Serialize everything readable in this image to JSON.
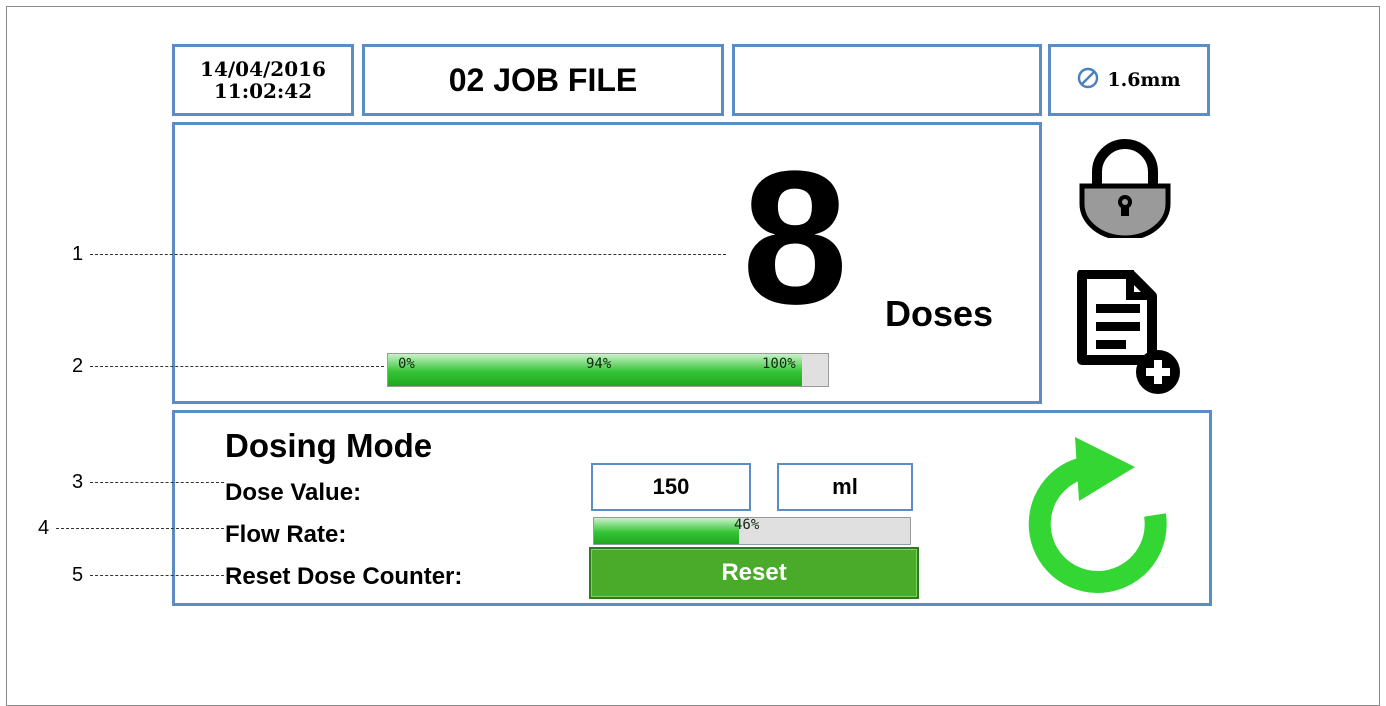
{
  "header": {
    "date": "14/04/2016",
    "time": "11:02:42",
    "job_title": "02 JOB FILE",
    "blank_field": "",
    "nozzle_size": "1.6mm",
    "nozzle_icon": "nozzle-diameter-icon"
  },
  "counter": {
    "dose_count": "8",
    "unit_label": "Doses",
    "progress": {
      "value_percent": 94,
      "label_min": "0%",
      "label_current": "94%",
      "label_max": "100%"
    }
  },
  "side_icons": {
    "lock": "padlock-icon",
    "file_add": "file-add-icon"
  },
  "dosing": {
    "title": "Dosing Mode",
    "dose_value_label": "Dose Value:",
    "dose_value": "150",
    "dose_unit": "ml",
    "flow_rate_label": "Flow Rate:",
    "flow_rate_percent": 46,
    "flow_rate_text": "46%",
    "reset_label": "Reset Dose Counter:",
    "reset_button": "Reset",
    "refresh_icon": "refresh-icon"
  },
  "callouts": [
    "1",
    "2",
    "3",
    "4",
    "5"
  ],
  "colors": {
    "panel_border": "#5b8dc4",
    "progress_green": "#37c337",
    "reset_button": "#4aaa2a",
    "refresh_icon": "#33d633"
  }
}
